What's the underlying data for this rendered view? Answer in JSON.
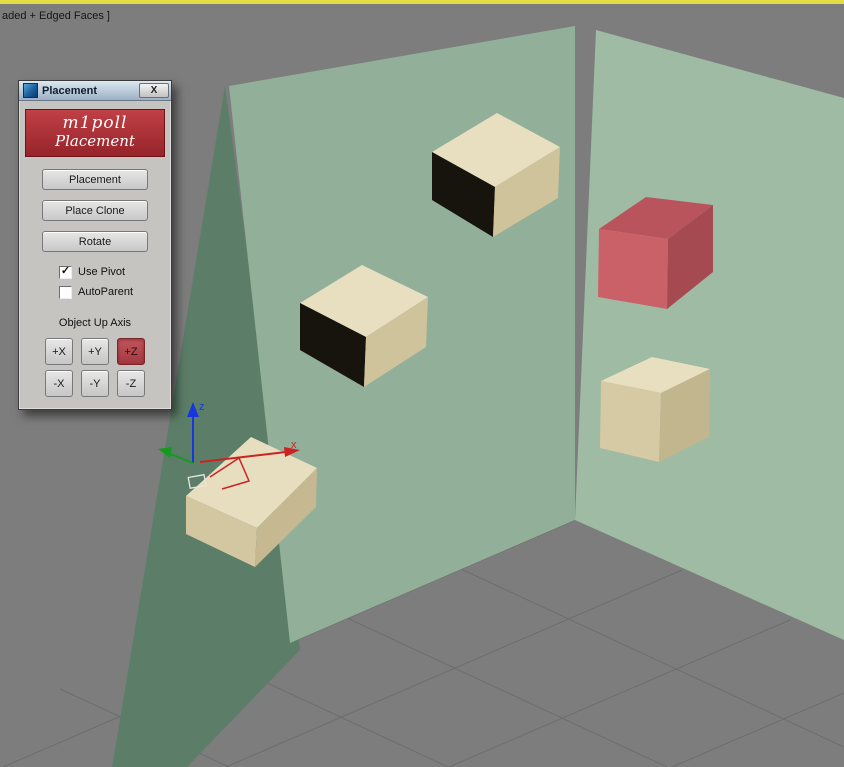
{
  "viewport": {
    "shading_label": "aded + Edged Faces ]"
  },
  "dialog": {
    "title": "Placement",
    "close_label": "X",
    "banner": {
      "line1": "m1poll",
      "line2": "Placement"
    },
    "buttons": [
      {
        "label": "Placement"
      },
      {
        "label": "Place Clone"
      },
      {
        "label": "Rotate"
      }
    ],
    "checkboxes": [
      {
        "label": "Use Pivot",
        "checked": true,
        "glyph": "✓"
      },
      {
        "label": "AutoParent",
        "checked": false,
        "glyph": ""
      }
    ],
    "axis_section_label": "Object Up Axis",
    "axis_buttons": [
      {
        "label": "+X",
        "active": false
      },
      {
        "label": "+Y",
        "active": false
      },
      {
        "label": "+Z",
        "active": true
      },
      {
        "label": "-X",
        "active": false
      },
      {
        "label": "-Y",
        "active": false
      },
      {
        "label": "-Z",
        "active": false
      }
    ]
  },
  "gizmo": {
    "x_label": "x",
    "z_label": "z"
  },
  "colors": {
    "viewport_border": "#e3dd43",
    "floor": "#7d7d7d",
    "grid": "#6d6d6d",
    "wall_left": "#5c7e68",
    "wall_front": "#92af99",
    "wall_right": "#9fbba4",
    "beige_top": "#e8dfc0",
    "beige_left_dark": "#17130d",
    "beige_right": "#cfc39c",
    "red_top": "#b9545c",
    "red_front": "#ca6169",
    "red_right": "#a64a52",
    "cube4_top": "#e8dfc0",
    "cube4_front": "#d6caa5",
    "cube4_right": "#c2b68f",
    "cube5_top": "#e7dec0",
    "cube5_left": "#d3c7a2",
    "cube5_right": "#c6b992",
    "axis_x": "#cc2222",
    "axis_y": "#17991f",
    "axis_z": "#1836dd",
    "banner_bg": "#b23237",
    "active_axis_bg": "#b5494f"
  }
}
